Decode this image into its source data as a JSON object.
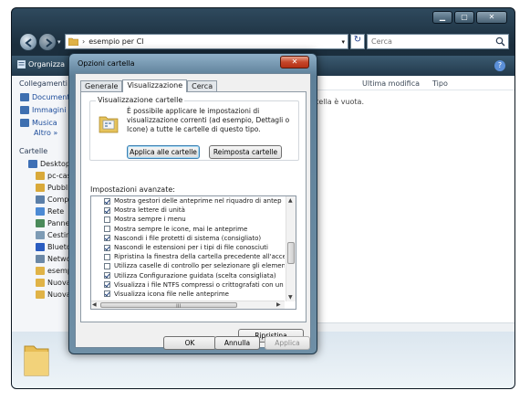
{
  "window": {
    "controls": {
      "minimize": "▁",
      "maximize": "▢",
      "close": "✕"
    }
  },
  "address": {
    "separator": "›",
    "path": "esempio per CI",
    "search_placeholder": "Cerca"
  },
  "toolbar": {
    "organize": "Organizza"
  },
  "nav": {
    "links_header": "Collegamenti",
    "links": [
      "Documenti",
      "Immagini",
      "Musica"
    ],
    "more": "Altro »",
    "folders_header": "Cartelle",
    "tree": [
      {
        "label": "Desktop",
        "icon": "desktop-icon",
        "color": "#3d6fb5",
        "indent": 0
      },
      {
        "label": "pc-cas",
        "icon": "user-folder-icon",
        "color": "#d9a93a",
        "indent": 1
      },
      {
        "label": "Pubbli",
        "icon": "public-folder-icon",
        "color": "#d9a93a",
        "indent": 1
      },
      {
        "label": "Compi",
        "icon": "computer-icon",
        "color": "#5b7fa8",
        "indent": 1
      },
      {
        "label": "Rete",
        "icon": "network-icon",
        "color": "#4c8ad4",
        "indent": 1
      },
      {
        "label": "Panne",
        "icon": "control-panel-icon",
        "color": "#4a8a5a",
        "indent": 1
      },
      {
        "label": "Cestin",
        "icon": "recycle-bin-icon",
        "color": "#7d9bb5",
        "indent": 1
      },
      {
        "label": "Blueto",
        "icon": "bluetooth-icon",
        "color": "#2a5cc0",
        "indent": 1
      },
      {
        "label": "Netwo",
        "icon": "network-folder-icon",
        "color": "#6b88a6",
        "indent": 1
      },
      {
        "label": "esemp",
        "icon": "folder-icon",
        "color": "#e0b347",
        "indent": 1
      },
      {
        "label": "Nuova",
        "icon": "folder-icon",
        "color": "#e0b347",
        "indent": 1
      },
      {
        "label": "Nuova",
        "icon": "folder-icon",
        "color": "#e0b347",
        "indent": 1
      }
    ]
  },
  "content": {
    "columns": [
      "Ultima modifica",
      "Tipo"
    ],
    "empty_message": "rtella è vuota."
  },
  "dialog": {
    "title": "Opzioni cartella",
    "close": "✕",
    "tabs": [
      "Generale",
      "Visualizzazione",
      "Cerca"
    ],
    "active_tab": 1,
    "group_label": "Visualizzazione cartelle",
    "group_desc": "È possibile applicare le impostazioni di visualizzazione correnti (ad esempio, Dettagli o Icone) a tutte le cartelle di questo tipo.",
    "apply_all_button": "Applica alle cartelle",
    "reset_folders_button": "Reimposta cartelle",
    "advanced_label": "Impostazioni avanzate:",
    "advanced_items": [
      {
        "label": "Mostra gestori delle anteprime nel riquadro di antep",
        "checked": true
      },
      {
        "label": "Mostra lettere di unità",
        "checked": true
      },
      {
        "label": "Mostra sempre i menu",
        "checked": false
      },
      {
        "label": "Mostra sempre le icone, mai le anteprime",
        "checked": false
      },
      {
        "label": "Nascondi i file protetti di sistema (consigliato)",
        "checked": true
      },
      {
        "label": "Nascondi le estensioni per i tipi di file conosciuti",
        "checked": true
      },
      {
        "label": "Ripristina la finestra della cartella precedente all'acce",
        "checked": false
      },
      {
        "label": "Utilizza caselle di controllo per selezionare gli elemen",
        "checked": false
      },
      {
        "label": "Utilizza Configurazione guidata (scelta consigliata)",
        "checked": true
      },
      {
        "label": "Visualizza i file NTFS compressi o crittografati con un",
        "checked": true
      },
      {
        "label": "Visualizza icona file nelle anteprime",
        "checked": true
      }
    ],
    "hscroll_grip": "III",
    "restore_button": "Ripristina",
    "ok_button": "OK",
    "cancel_button": "Annulla",
    "apply_button": "Applica"
  }
}
